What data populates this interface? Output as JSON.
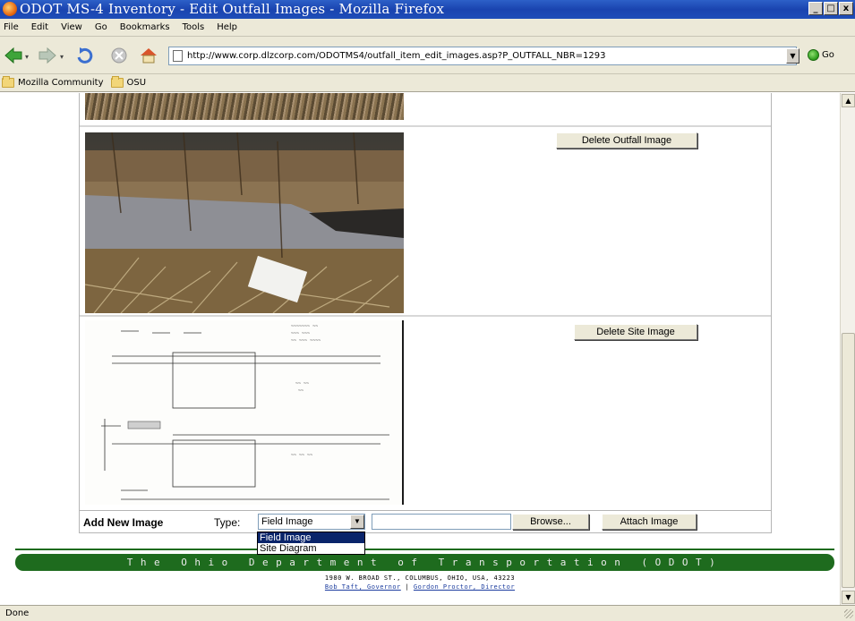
{
  "window": {
    "title": "ODOT MS-4 Inventory - Edit Outfall Images - Mozilla Firefox",
    "minimize": "_",
    "maximize": "□",
    "close": "x"
  },
  "menu": [
    "File",
    "Edit",
    "View",
    "Go",
    "Bookmarks",
    "Tools",
    "Help"
  ],
  "navbar": {
    "url": "http://www.corp.dlzcorp.com/ODOTMS4/outfall_item_edit_images.asp?P_OUTFALL_NBR=1293",
    "go_label": "Go"
  },
  "bookmarks": [
    "Mozilla Community",
    "OSU"
  ],
  "content": {
    "delete_outfall_label": "Delete Outfall Image",
    "delete_site_label": "Delete Site Image",
    "add_new_image_label": "Add New Image",
    "type_label": "Type:",
    "type_selected": "Field Image",
    "type_options": [
      "Field Image",
      "Site Diagram"
    ],
    "file_value": "",
    "browse_label": "Browse...",
    "attach_label": "Attach Image"
  },
  "footer": {
    "banner": "The Ohio Department of Transportation (ODOT)",
    "address": "1980 W. BROAD ST., COLUMBUS, OHIO, USA, 43223",
    "governor_link": "Bob Taft, Governor",
    "separator": "|",
    "director_link": "Gordon Proctor, Director"
  },
  "status": "Done"
}
